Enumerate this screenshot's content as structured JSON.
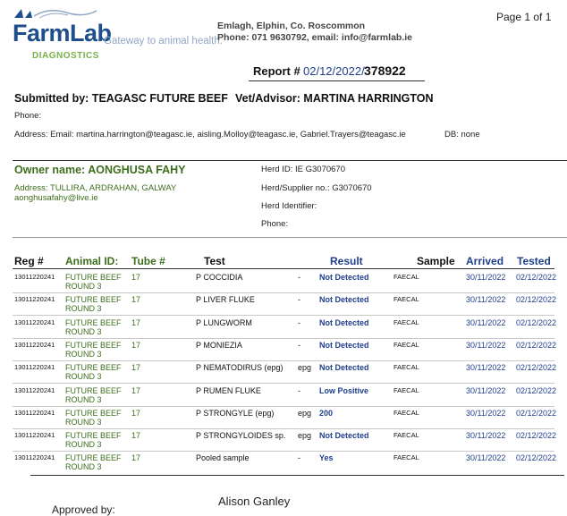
{
  "header": {
    "logo_text": "FarmLab",
    "tagline": "Gateway to animal health.",
    "division": "DIAGNOSTICS",
    "address_line1": "Emlagh, Elphin, Co. Roscommon",
    "address_line2": "Phone: 071 9630792, email: info@farmlab.ie",
    "page": "Page 1 of 1"
  },
  "report": {
    "label": "Report #",
    "date": "02/12/2022/",
    "number": "378922"
  },
  "submitter": {
    "submitted_by": "Submitted by: TEAGASC FUTURE BEEF",
    "vet": "Vet/Advisor: MARTINA HARRINGTON",
    "phone_label": "Phone:",
    "address": "Address:  Email: martina.harrington@teagasc.ie, aisling.Molloy@teagasc.ie, Gabriel.Trayers@teagasc.ie",
    "db": "DB: none"
  },
  "owner": {
    "name": "Owner name: AONGHUSA FAHY",
    "address": "Address: TULLIRA, ARDRAHAN, GALWAY",
    "email": "aonghusafahy@live.ie",
    "herd_id": "Herd ID:  IE G3070670",
    "herd_supplier": "Herd/Supplier no.: G3070670",
    "herd_identifier": "Herd Identifier:",
    "phone": "Phone:"
  },
  "table": {
    "headers": {
      "reg": "Reg #",
      "animal": "Animal ID:",
      "tube": "Tube #",
      "test": "Test",
      "result": "Result",
      "sample": "Sample",
      "arrived": "Arrived",
      "tested": "Tested"
    },
    "rows": [
      {
        "reg": "13011220241",
        "animal1": "FUTURE BEEF",
        "animal2": "ROUND 3",
        "tube": "17",
        "test": "P COCCIDIA",
        "unit": "-",
        "result": "Not Detected",
        "sample": "FAECAL",
        "arrived": "30/11/2022",
        "tested": "02/12/2022"
      },
      {
        "reg": "13011220241",
        "animal1": "FUTURE BEEF",
        "animal2": "ROUND 3",
        "tube": "17",
        "test": "P LIVER FLUKE",
        "unit": "-",
        "result": "Not Detected",
        "sample": "FAECAL",
        "arrived": "30/11/2022",
        "tested": "02/12/2022"
      },
      {
        "reg": "13011220241",
        "animal1": "FUTURE BEEF",
        "animal2": "ROUND 3",
        "tube": "17",
        "test": "P LUNGWORM",
        "unit": "-",
        "result": "Not Detected",
        "sample": "FAECAL",
        "arrived": "30/11/2022",
        "tested": "02/12/2022"
      },
      {
        "reg": "13011220241",
        "animal1": "FUTURE BEEF",
        "animal2": "ROUND 3",
        "tube": "17",
        "test": "P MONIEZIA",
        "unit": "-",
        "result": "Not Detected",
        "sample": "FAECAL",
        "arrived": "30/11/2022",
        "tested": "02/12/2022"
      },
      {
        "reg": "13011220241",
        "animal1": "FUTURE BEEF",
        "animal2": "ROUND 3",
        "tube": "17",
        "test": "P NEMATODIRUS (epg)",
        "unit": "epg",
        "result": "Not Detected",
        "sample": "FAECAL",
        "arrived": "30/11/2022",
        "tested": "02/12/2022"
      },
      {
        "reg": "13011220241",
        "animal1": "FUTURE BEEF",
        "animal2": "ROUND 3",
        "tube": "17",
        "test": "P RUMEN FLUKE",
        "unit": "-",
        "result": "Low Positive",
        "sample": "FAECAL",
        "arrived": "30/11/2022",
        "tested": "02/12/2022"
      },
      {
        "reg": "13011220241",
        "animal1": "FUTURE BEEF",
        "animal2": "ROUND 3",
        "tube": "17",
        "test": "P STRONGYLE (epg)",
        "unit": "epg",
        "result": "200",
        "sample": "FAECAL",
        "arrived": "30/11/2022",
        "tested": "02/12/2022"
      },
      {
        "reg": "13011220241",
        "animal1": "FUTURE BEEF",
        "animal2": "ROUND 3",
        "tube": "17",
        "test": "P STRONGYLOIDES sp.",
        "unit": "epg",
        "result": "Not Detected",
        "sample": "FAECAL",
        "arrived": "30/11/2022",
        "tested": "02/12/2022"
      },
      {
        "reg": "13011220241",
        "animal1": "FUTURE BEEF",
        "animal2": "ROUND 3",
        "tube": "17",
        "test": "Pooled sample",
        "unit": "-",
        "result": "Yes",
        "sample": "FAECAL",
        "arrived": "30/11/2022",
        "tested": "02/12/2022"
      }
    ]
  },
  "footer": {
    "approved_label": "Approved by:",
    "signer": "Alison Ganley"
  },
  "colors": {
    "brand_blue": "#1f4e8c",
    "brand_green": "#7ab04a",
    "field_green": "#3d6e1d",
    "value_blue": "#1f3e8c"
  }
}
